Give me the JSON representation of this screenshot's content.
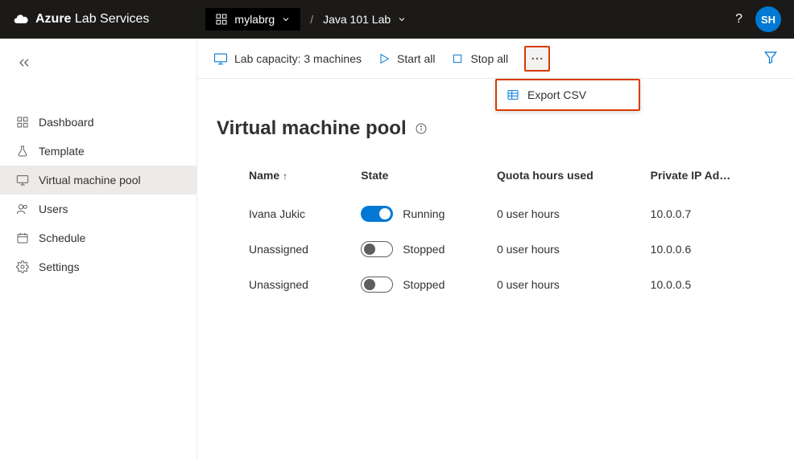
{
  "header": {
    "brand_bold": "Azure",
    "brand_rest": "Lab Services",
    "resource_group": "mylabrg",
    "lab_name": "Java 101 Lab",
    "user_initials": "SH"
  },
  "sidebar": {
    "items": [
      {
        "key": "dashboard",
        "label": "Dashboard"
      },
      {
        "key": "template",
        "label": "Template"
      },
      {
        "key": "vm-pool",
        "label": "Virtual machine pool"
      },
      {
        "key": "users",
        "label": "Users"
      },
      {
        "key": "schedule",
        "label": "Schedule"
      },
      {
        "key": "settings",
        "label": "Settings"
      }
    ],
    "active": "vm-pool"
  },
  "commandbar": {
    "lab_capacity_label": "Lab capacity: 3 machines",
    "start_all": "Start all",
    "stop_all": "Stop all",
    "export_csv": "Export CSV"
  },
  "page": {
    "title": "Virtual machine pool"
  },
  "table": {
    "columns": {
      "name": "Name",
      "state": "State",
      "quota": "Quota hours used",
      "ip": "Private IP Ad…"
    },
    "rows": [
      {
        "name": "Ivana Jukic",
        "state_label": "Running",
        "running": true,
        "quota": "0 user hours",
        "ip": "10.0.0.7"
      },
      {
        "name": "Unassigned",
        "state_label": "Stopped",
        "running": false,
        "quota": "0 user hours",
        "ip": "10.0.0.6"
      },
      {
        "name": "Unassigned",
        "state_label": "Stopped",
        "running": false,
        "quota": "0 user hours",
        "ip": "10.0.0.5"
      }
    ]
  },
  "breadcrumb_separator": "/"
}
